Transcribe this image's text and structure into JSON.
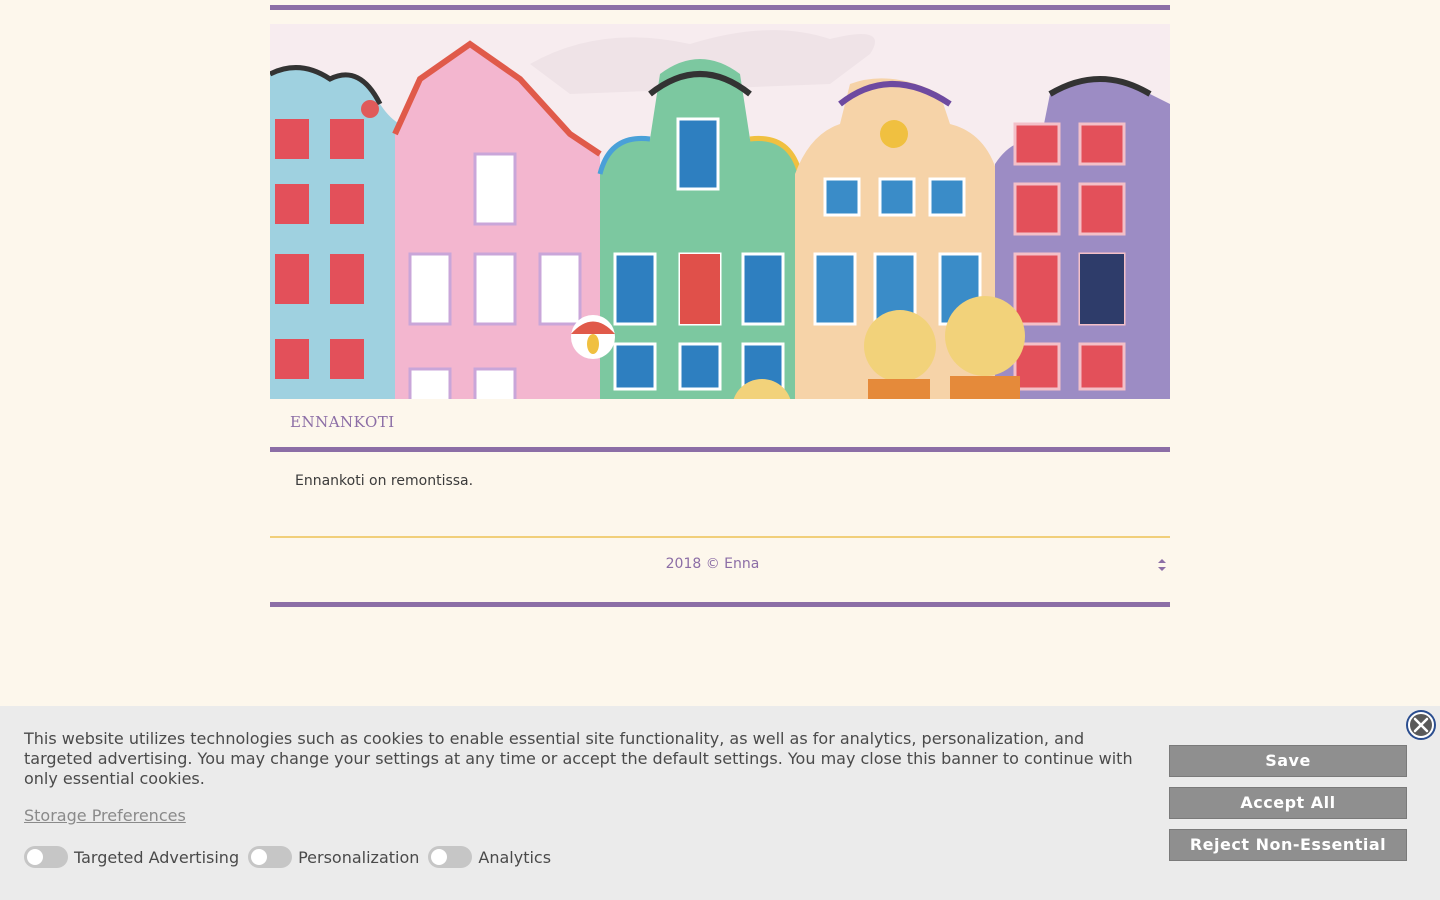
{
  "colors": {
    "page_background": "#fdf7ec",
    "accent_purple": "#8c6ea6",
    "accent_yellow": "#f1cf7a",
    "banner_background": "#ebebeb",
    "button_gray": "#8f8f8f",
    "close_blue": "#2a4d8f"
  },
  "header": {
    "image_icon": "illustrated-row-of-houses"
  },
  "nav": {
    "home_label": "ENNANKOTI"
  },
  "main": {
    "text": "Ennankoti on remontissa."
  },
  "footer": {
    "copyright": "2018 © Enna",
    "scroll_icon": "up-down-arrows-icon"
  },
  "cookie_banner": {
    "message": "This website utilizes technologies such as cookies to enable essential site functionality, as well as for analytics, personalization, and targeted advertising. You may change your settings at any time or accept the default settings. You may close this banner to continue with only essential cookies.",
    "storage_link": "Storage Preferences",
    "toggles": [
      {
        "label": "Targeted Advertising",
        "on": false
      },
      {
        "label": "Personalization",
        "on": false
      },
      {
        "label": "Analytics",
        "on": false
      }
    ],
    "buttons": {
      "save": "Save",
      "accept_all": "Accept All",
      "reject": "Reject Non-Essential"
    },
    "close_icon": "close-icon"
  }
}
